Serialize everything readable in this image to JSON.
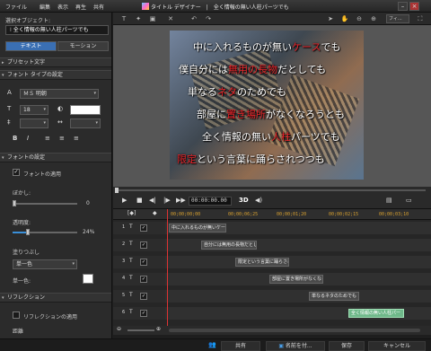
{
  "menu": [
    "ファイル",
    "編集",
    "表示",
    "再生",
    "共有"
  ],
  "window": {
    "title": "タイトル デザイナー　|　全く情報の無い人柱パーツでも"
  },
  "left": {
    "object_label": "選択オブジェクト:",
    "object_value": "全く情報の無い人柱パーツでも",
    "tabs": [
      "テキスト",
      "モーション"
    ],
    "preset_label": "プリセット文字",
    "font_type_label": "フォント タイプの設定",
    "font_name": "ＭＳ 明朝",
    "font_size": "18",
    "font_section_label": "フォントの設定",
    "font_apply_label": "フォントの適用",
    "blur_label": "ぼかし:",
    "blur_value": "0",
    "opacity_label": "透明度:",
    "opacity_value": "24%",
    "opacity_level": 0.24,
    "fill_label": "塗りつぶし",
    "fill_value": "単一色",
    "single_color_label": "単一色:",
    "reflection_section_label": "リフレクション",
    "reflection_apply_label": "リフレクションの適用",
    "distance_label": "距離"
  },
  "toolbar": {
    "zoom": "フィ..."
  },
  "preview": {
    "lines": [
      [
        [
          "中に入れるものが無い",
          false
        ],
        [
          "ケース",
          true
        ],
        [
          "でも",
          false
        ]
      ],
      [
        [
          "僕自分には",
          false
        ],
        [
          "無用の長物",
          true
        ],
        [
          "だとしても",
          false
        ]
      ],
      [
        [
          "単なる",
          false
        ],
        [
          "ネタ",
          true
        ],
        [
          "のためでも",
          false
        ]
      ],
      [
        [
          "部屋に",
          false
        ],
        [
          "置き場所",
          true
        ],
        [
          "がなくなろうとも",
          false
        ]
      ],
      [
        [
          "全く情報の無い",
          false
        ],
        [
          "人柱",
          true
        ],
        [
          "パーツでも",
          false
        ]
      ],
      [
        [
          "限定",
          true
        ],
        [
          "という言葉に踊らされつつも",
          false
        ]
      ]
    ]
  },
  "controls": {
    "timecode": "00:00:00.00",
    "mode": "3D"
  },
  "timeline": {
    "timecodes": [
      "00;00;00;00",
      "00;00;06;25",
      "00;00;01;20",
      "00;00;02;15",
      "00;00;03;10"
    ],
    "tracks": [
      {
        "num": "1",
        "clip": "中に入れるものが無いケー"
      },
      {
        "num": "2",
        "clip": "自分には無用の長物だとし"
      },
      {
        "num": "3",
        "clip": "限定という言葉に踊らされ"
      },
      {
        "num": "4",
        "clip": "部屋に置き場所がなくなろ"
      },
      {
        "num": "5",
        "clip": "単なるネタのためでも"
      },
      {
        "num": "6",
        "clip": "全く情報の無い人柱パー"
      }
    ]
  },
  "bottom": {
    "share": "共有",
    "save_as": "名前を付...",
    "save": "保存",
    "cancel": "キャンセル"
  }
}
